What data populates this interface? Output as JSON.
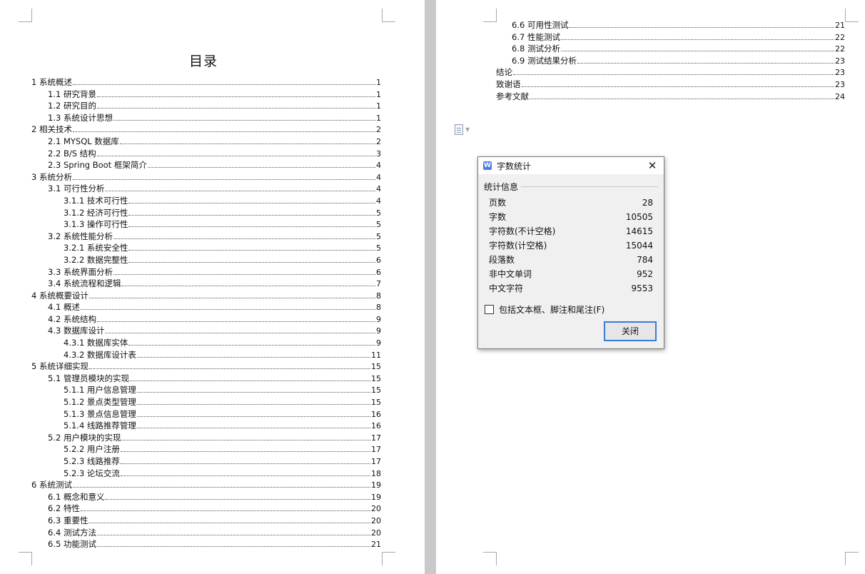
{
  "document": {
    "toc_title": "目录",
    "left_page_entries": [
      {
        "text": "1 系统概述",
        "page": "1",
        "level": 0
      },
      {
        "text": "1.1 研究背景",
        "page": "1",
        "level": 1
      },
      {
        "text": "1.2 研究目的",
        "page": "1",
        "level": 1
      },
      {
        "text": "1.3 系统设计思想",
        "page": "1",
        "level": 1
      },
      {
        "text": "2 相关技术",
        "page": "2",
        "level": 0
      },
      {
        "text": "2.1 MYSQL 数据库",
        "page": "2",
        "level": 1
      },
      {
        "text": "2.2 B/S 结构",
        "page": "3",
        "level": 1
      },
      {
        "text": "2.3 Spring Boot 框架简介",
        "page": "4",
        "level": 1
      },
      {
        "text": "3 系统分析",
        "page": "4",
        "level": 0
      },
      {
        "text": "3.1 可行性分析",
        "page": "4",
        "level": 1
      },
      {
        "text": "3.1.1 技术可行性",
        "page": "4",
        "level": 2
      },
      {
        "text": "3.1.2 经济可行性",
        "page": "5",
        "level": 2
      },
      {
        "text": "3.1.3 操作可行性",
        "page": "5",
        "level": 2
      },
      {
        "text": "3.2 系统性能分析",
        "page": "5",
        "level": 1
      },
      {
        "text": "3.2.1 系统安全性",
        "page": "5",
        "level": 2
      },
      {
        "text": "3.2.2 数据完整性",
        "page": "6",
        "level": 2
      },
      {
        "text": "3.3 系统界面分析",
        "page": "6",
        "level": 1
      },
      {
        "text": "3.4 系统流程和逻辑",
        "page": "7",
        "level": 1
      },
      {
        "text": "4 系统概要设计",
        "page": "8",
        "level": 0
      },
      {
        "text": "4.1 概述",
        "page": "8",
        "level": 1
      },
      {
        "text": "4.2 系统结构",
        "page": "9",
        "level": 1
      },
      {
        "text": "4.3 数据库设计",
        "page": "9",
        "level": 1
      },
      {
        "text": "4.3.1 数据库实体",
        "page": "9",
        "level": 2
      },
      {
        "text": "4.3.2 数据库设计表",
        "page": "11",
        "level": 2
      },
      {
        "text": "5 系统详细实现",
        "page": "15",
        "level": 0
      },
      {
        "text": "5.1 管理员模块的实现",
        "page": "15",
        "level": 1
      },
      {
        "text": "5.1.1 用户信息管理",
        "page": "15",
        "level": 2
      },
      {
        "text": "5.1.2 景点类型管理",
        "page": "15",
        "level": 2
      },
      {
        "text": "5.1.3 景点信息管理",
        "page": "16",
        "level": 2
      },
      {
        "text": "5.1.4 线路推荐管理",
        "page": "16",
        "level": 2
      },
      {
        "text": "5.2 用户模块的实现",
        "page": "17",
        "level": 1
      },
      {
        "text": "5.2.2 用户注册",
        "page": "17",
        "level": 2
      },
      {
        "text": "5.2.3 线路推荐",
        "page": "17",
        "level": 2
      },
      {
        "text": "5.2.3 论坛交流",
        "page": "18",
        "level": 2
      },
      {
        "text": "6 系统测试",
        "page": "19",
        "level": 0
      },
      {
        "text": "6.1 概念和意义",
        "page": "19",
        "level": 1
      },
      {
        "text": "6.2 特性",
        "page": "20",
        "level": 1
      },
      {
        "text": "6.3 重要性",
        "page": "20",
        "level": 1
      },
      {
        "text": "6.4 测试方法",
        "page": "20",
        "level": 1
      },
      {
        "text": "6.5 功能测试",
        "page": "21",
        "level": 1
      }
    ],
    "right_page_entries": [
      {
        "text": "6.6 可用性测试",
        "page": "21",
        "level": 2
      },
      {
        "text": "6.7 性能测试",
        "page": "22",
        "level": 2
      },
      {
        "text": "6.8 测试分析",
        "page": "22",
        "level": 2
      },
      {
        "text": "6.9 测试结果分析",
        "page": "23",
        "level": 2
      },
      {
        "text": "结论",
        "page": "23",
        "level": 1
      },
      {
        "text": "致谢语",
        "page": "23",
        "level": 1
      },
      {
        "text": "参考文献",
        "page": "24",
        "level": 1
      }
    ]
  },
  "doc_widget": {
    "icon": "document-icon",
    "caret": "chevron-down-icon"
  },
  "dialog": {
    "title": "字数统计",
    "app_icon_glyph": "W",
    "close_glyph": "✕",
    "section_label": "统计信息",
    "stats": [
      {
        "label": "页数",
        "value": "28"
      },
      {
        "label": "字数",
        "value": "10505"
      },
      {
        "label": "字符数(不计空格)",
        "value": "14615"
      },
      {
        "label": "字符数(计空格)",
        "value": "15044"
      },
      {
        "label": "段落数",
        "value": "784"
      },
      {
        "label": "非中文单词",
        "value": "952"
      },
      {
        "label": "中文字符",
        "value": "9553"
      }
    ],
    "checkbox_label": "包括文本框、脚注和尾注(F)",
    "checkbox_checked": false,
    "close_button_label": "关闭",
    "accent_color": "#3d7bd8"
  }
}
